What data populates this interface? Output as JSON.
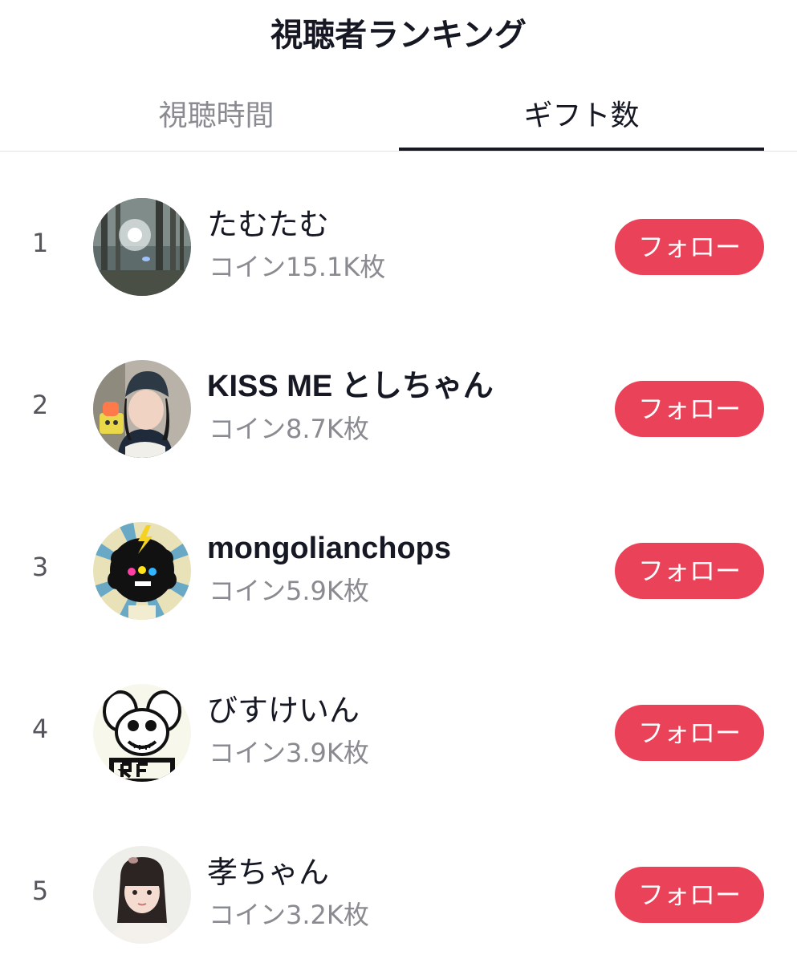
{
  "header": {
    "title": "視聴者ランキング"
  },
  "tabs": [
    {
      "label": "視聴時間",
      "active": false
    },
    {
      "label": "ギフト数",
      "active": true
    }
  ],
  "colors": {
    "accent": "#ea4359",
    "text_primary": "#161823",
    "text_secondary": "#8a8b91"
  },
  "viewers": [
    {
      "rank": "1",
      "name": "たむたむ",
      "coins": "コイン15.1K枚",
      "follow_label": "フォロー",
      "avatar": "forest-sunlight-photo"
    },
    {
      "rank": "2",
      "name": "KISS ME としちゃん",
      "coins": "コイン8.7K枚",
      "follow_label": "フォロー",
      "avatar": "woman-beanie-photo"
    },
    {
      "rank": "3",
      "name": "mongolianchops",
      "coins": "コイン5.9K枚",
      "follow_label": "フォロー",
      "avatar": "afro-character-illustration"
    },
    {
      "rank": "4",
      "name": "びすけいん",
      "coins": "コイン3.9K枚",
      "follow_label": "フォロー",
      "avatar": "rat-fink-illustration"
    },
    {
      "rank": "5",
      "name": "孝ちゃん",
      "coins": "コイン3.2K枚",
      "follow_label": "フォロー",
      "avatar": "woman-bangs-photo"
    }
  ]
}
